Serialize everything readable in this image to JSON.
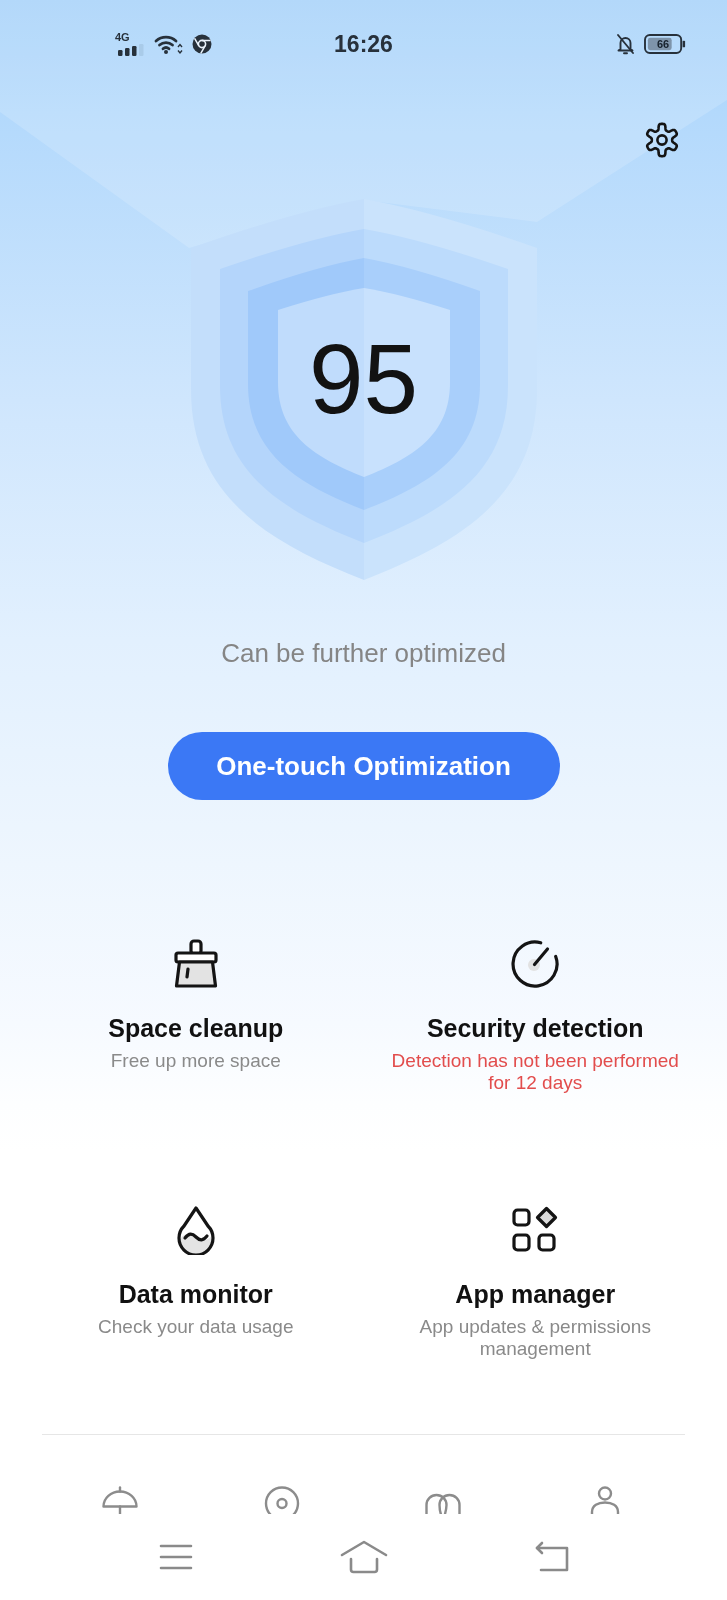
{
  "status_bar": {
    "network": "4G",
    "time": "16:26",
    "battery": "66"
  },
  "score": {
    "value": "95",
    "message": "Can be further optimized"
  },
  "optimize_button": {
    "label": "One-touch Optimization"
  },
  "features": [
    {
      "title": "Space cleanup",
      "subtitle": "Free up more space",
      "alert": false
    },
    {
      "title": "Security detection",
      "subtitle": "Detection has not been performed for 12 days",
      "alert": true
    },
    {
      "title": "Data monitor",
      "subtitle": "Check your data usage",
      "alert": false
    },
    {
      "title": "App manager",
      "subtitle": "App updates & permissions management",
      "alert": false
    }
  ]
}
